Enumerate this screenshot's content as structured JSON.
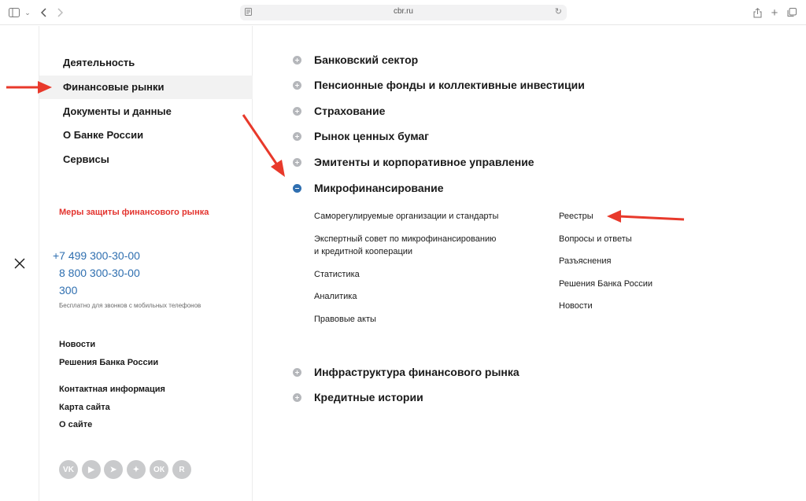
{
  "browser": {
    "url": "cbr.ru",
    "icons": [
      "sidebar-icon",
      "chevron-down-icon",
      "back-icon",
      "forward-icon",
      "reader-icon",
      "reload-icon",
      "share-icon",
      "new-tab-icon",
      "tabs-overview-icon"
    ]
  },
  "sidebar": {
    "nav": [
      {
        "label": "Деятельность",
        "active": false
      },
      {
        "label": "Финансовые рынки",
        "active": true
      },
      {
        "label": "Документы и данные",
        "active": false
      },
      {
        "label": "О Банке России",
        "active": false
      },
      {
        "label": "Сервисы",
        "active": false
      }
    ],
    "protection_link": "Меры защиты финансового рынка",
    "phones": [
      "+7 499 300-30-00",
      "8 800 300-30-00",
      "300"
    ],
    "phone_note": "Бесплатно для звонков с мобильных телефонов",
    "footer_links": [
      "Новости",
      "Решения Банка России",
      "Контактная информация",
      "Карта сайта",
      "О сайте"
    ],
    "socials": [
      {
        "name": "vk-icon",
        "glyph": "VK"
      },
      {
        "name": "youtube-icon",
        "glyph": "▶"
      },
      {
        "name": "telegram-icon",
        "glyph": "➤"
      },
      {
        "name": "dzen-icon",
        "glyph": "✦"
      },
      {
        "name": "odnoklassniki-icon",
        "glyph": "ОК"
      },
      {
        "name": "rutube-icon",
        "glyph": "R"
      }
    ]
  },
  "main": {
    "sections": [
      {
        "label": "Банковский сектор",
        "expanded": false
      },
      {
        "label": "Пенсионные фонды и коллективные инвестиции",
        "expanded": false
      },
      {
        "label": "Страхование",
        "expanded": false
      },
      {
        "label": "Рынок ценных бумаг",
        "expanded": false
      },
      {
        "label": "Эмитенты и корпоративное управление",
        "expanded": false
      },
      {
        "label": "Микрофинансирование",
        "expanded": true
      },
      {
        "label": "Инфраструктура финансового рынка",
        "expanded": false
      },
      {
        "label": "Кредитные истории",
        "expanded": false
      }
    ],
    "sub_left": [
      "Саморегулируемые организации и стандарты",
      "Экспертный совет по микрофинансированию\nи кредитной кооперации",
      "Статистика",
      "Аналитика",
      "Правовые акты"
    ],
    "sub_right": [
      "Реестры",
      "Вопросы и ответы",
      "Разъяснения",
      "Решения Банка России",
      "Новости"
    ]
  },
  "colors": {
    "accent_blue": "#2f6fb0",
    "warning_red": "#e3342f",
    "arrow_red": "#e8392b",
    "icon_gray": "#b5b7bb"
  }
}
